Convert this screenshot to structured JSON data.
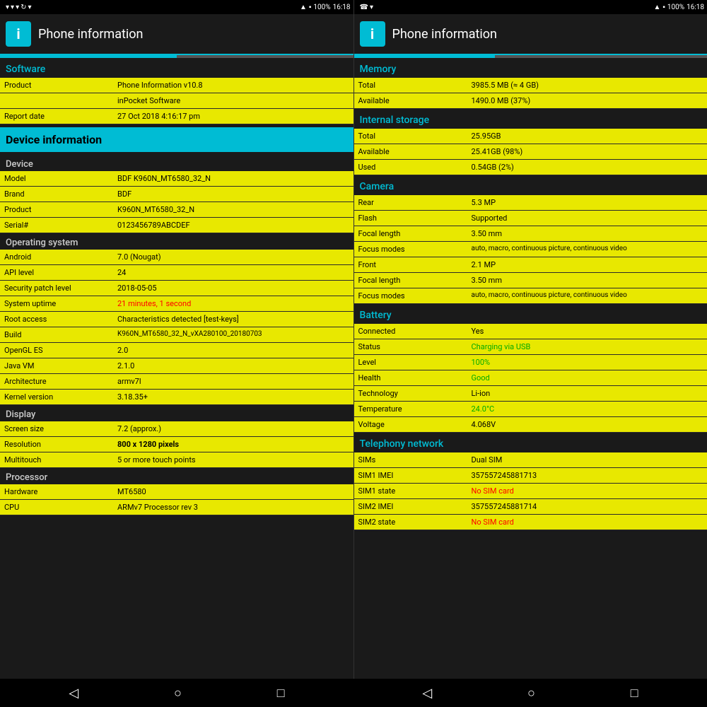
{
  "statusBar": {
    "left": {
      "battery": "100%",
      "time": "16:18"
    },
    "right": {
      "battery": "100%",
      "time": "16:18"
    }
  },
  "leftPanel": {
    "appTitle": "Phone information",
    "tabs": [
      "active",
      "inactive"
    ],
    "sections": {
      "software": {
        "label": "Software",
        "rows": [
          {
            "key": "Product",
            "value": "Phone Information v10.8",
            "style": "yellow"
          },
          {
            "key": "",
            "value": "inPocket Software",
            "style": "yellow"
          },
          {
            "key": "Report date",
            "value": "27 Oct 2018 4:16:17 pm",
            "style": "yellow"
          }
        ]
      },
      "deviceInfo": {
        "banner": "Device information"
      },
      "device": {
        "label": "Device",
        "rows": [
          {
            "key": "Model",
            "value": "BDF K960N_MT6580_32_N",
            "style": "yellow"
          },
          {
            "key": "Brand",
            "value": "BDF",
            "style": "yellow"
          },
          {
            "key": "Product",
            "value": "K960N_MT6580_32_N",
            "style": "yellow"
          },
          {
            "key": "Serial#",
            "value": "0123456789ABCDEF",
            "style": "yellow"
          }
        ]
      },
      "os": {
        "label": "Operating system",
        "rows": [
          {
            "key": "Android",
            "value": "7.0 (Nougat)",
            "style": "yellow"
          },
          {
            "key": "API level",
            "value": "24",
            "style": "yellow"
          },
          {
            "key": "Security patch level",
            "value": "2018-05-05",
            "style": "yellow"
          },
          {
            "key": "System uptime",
            "value": "21 minutes, 1 second",
            "style": "yellow",
            "valColor": "red"
          },
          {
            "key": "Root access",
            "value": "Characteristics detected [test-keys]",
            "style": "yellow"
          },
          {
            "key": "Build",
            "value": "K960N_MT6580_32_N_vXA280100_20180703",
            "style": "yellow"
          },
          {
            "key": "OpenGL ES",
            "value": "2.0",
            "style": "yellow"
          },
          {
            "key": "Java VM",
            "value": "2.1.0",
            "style": "yellow"
          },
          {
            "key": "Architecture",
            "value": "armv7l",
            "style": "yellow"
          },
          {
            "key": "Kernel version",
            "value": "3.18.35+",
            "style": "yellow"
          }
        ]
      },
      "display": {
        "label": "Display",
        "rows": [
          {
            "key": "Screen size",
            "value": "7.2 (approx.)",
            "style": "yellow"
          },
          {
            "key": "Resolution",
            "value": "800 x 1280 pixels",
            "style": "yellow"
          },
          {
            "key": "Multitouch",
            "value": "5 or more touch points",
            "style": "yellow"
          }
        ]
      },
      "processor": {
        "label": "Processor",
        "rows": [
          {
            "key": "Hardware",
            "value": "MT6580",
            "style": "yellow"
          },
          {
            "key": "CPU",
            "value": "ARMv7 Processor rev 3",
            "style": "yellow"
          }
        ]
      }
    }
  },
  "rightPanel": {
    "appTitle": "Phone information",
    "sections": {
      "memory": {
        "label": "Memory",
        "rows": [
          {
            "key": "Total",
            "value": "3985.5 MB (≈ 4 GB)",
            "style": "yellow"
          },
          {
            "key": "Available",
            "value": "1490.0 MB (37%)",
            "style": "yellow"
          }
        ]
      },
      "storage": {
        "label": "Internal storage",
        "rows": [
          {
            "key": "Total",
            "value": "25.95GB",
            "style": "yellow"
          },
          {
            "key": "Available",
            "value": "25.41GB (98%)",
            "style": "yellow"
          },
          {
            "key": "Used",
            "value": "0.54GB (2%)",
            "style": "yellow"
          }
        ]
      },
      "camera": {
        "label": "Camera",
        "rear": [
          {
            "key": "Rear",
            "value": "5.3 MP",
            "style": "yellow"
          },
          {
            "key": "Flash",
            "value": "Supported",
            "style": "yellow"
          },
          {
            "key": "Focal length",
            "value": "3.50 mm",
            "style": "yellow"
          },
          {
            "key": "Focus modes",
            "value": "auto, macro, continuous picture, continuous video",
            "style": "yellow"
          }
        ],
        "front": [
          {
            "key": "Front",
            "value": "2.1 MP",
            "style": "yellow"
          },
          {
            "key": "Focal length",
            "value": "3.50 mm",
            "style": "yellow"
          },
          {
            "key": "Focus modes",
            "value": "auto, macro, continuous picture, continuous video",
            "style": "yellow"
          }
        ]
      },
      "battery": {
        "label": "Battery",
        "rows": [
          {
            "key": "Connected",
            "value": "Yes",
            "style": "yellow",
            "valColor": "normal"
          },
          {
            "key": "Status",
            "value": "Charging via USB",
            "style": "yellow",
            "valColor": "green"
          },
          {
            "key": "Level",
            "value": "100%",
            "style": "yellow",
            "valColor": "green"
          },
          {
            "key": "Health",
            "value": "Good",
            "style": "yellow",
            "valColor": "green"
          },
          {
            "key": "Technology",
            "value": "Li-ion",
            "style": "yellow",
            "valColor": "normal"
          },
          {
            "key": "Temperature",
            "value": "24.0°C",
            "style": "yellow",
            "valColor": "green"
          },
          {
            "key": "Voltage",
            "value": "4.068V",
            "style": "yellow",
            "valColor": "normal"
          }
        ]
      },
      "telephony": {
        "label": "Telephony network",
        "rows": [
          {
            "key": "SIMs",
            "value": "Dual SIM",
            "style": "yellow",
            "valColor": "normal"
          },
          {
            "key": "SIM1 IMEI",
            "value": "357557245881713",
            "style": "yellow",
            "valColor": "normal"
          },
          {
            "key": "SIM1 state",
            "value": "No SIM card",
            "style": "yellow",
            "valColor": "red"
          },
          {
            "key": "SIM2 IMEI",
            "value": "357557245881714",
            "style": "yellow",
            "valColor": "normal"
          },
          {
            "key": "SIM2 state",
            "value": "No SIM card",
            "style": "yellow",
            "valColor": "red"
          }
        ]
      }
    }
  },
  "bottomNav": {
    "back": "◁",
    "home": "○",
    "recent": "□"
  }
}
